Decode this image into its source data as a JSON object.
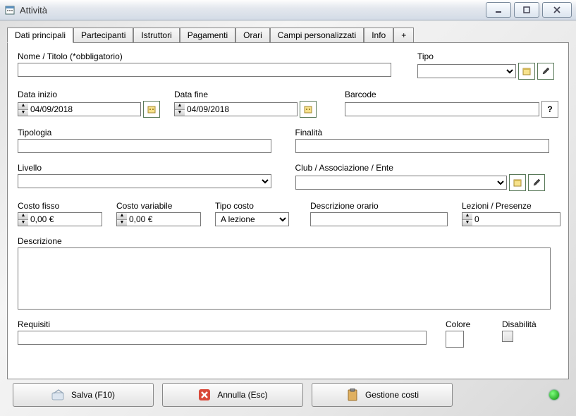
{
  "window": {
    "title": "Attività"
  },
  "tabs": [
    "Dati principali",
    "Partecipanti",
    "Istruttori",
    "Pagamenti",
    "Orari",
    "Campi personalizzati",
    "Info",
    "+"
  ],
  "labels": {
    "nome": "Nome / Titolo (*obbligatorio)",
    "tipo": "Tipo",
    "data_inizio": "Data inizio",
    "data_fine": "Data fine",
    "barcode": "Barcode",
    "tipologia": "Tipologia",
    "finalita": "Finalità",
    "livello": "Livello",
    "club": "Club / Associazione / Ente",
    "costo_fisso": "Costo fisso",
    "costo_variabile": "Costo variabile",
    "tipo_costo": "Tipo costo",
    "descr_orario": "Descrizione orario",
    "lezioni": "Lezioni / Presenze",
    "descrizione": "Descrizione",
    "requisiti": "Requisiti",
    "colore": "Colore",
    "disabilita": "Disabilità",
    "barcode_help": "?"
  },
  "values": {
    "nome": "",
    "data_inizio": "04/09/2018",
    "data_fine": "04/09/2018",
    "barcode": "",
    "tipologia": "",
    "finalita": "",
    "costo_fisso": "0,00 €",
    "costo_variabile": "0,00 €",
    "tipo_costo": "A lezione",
    "descr_orario": "",
    "lezioni": "0",
    "descrizione": "",
    "requisiti": ""
  },
  "buttons": {
    "salva": "Salva (F10)",
    "annulla": "Annulla (Esc)",
    "gestione": "Gestione costi"
  },
  "icons": {
    "app": "calendar-icon"
  }
}
